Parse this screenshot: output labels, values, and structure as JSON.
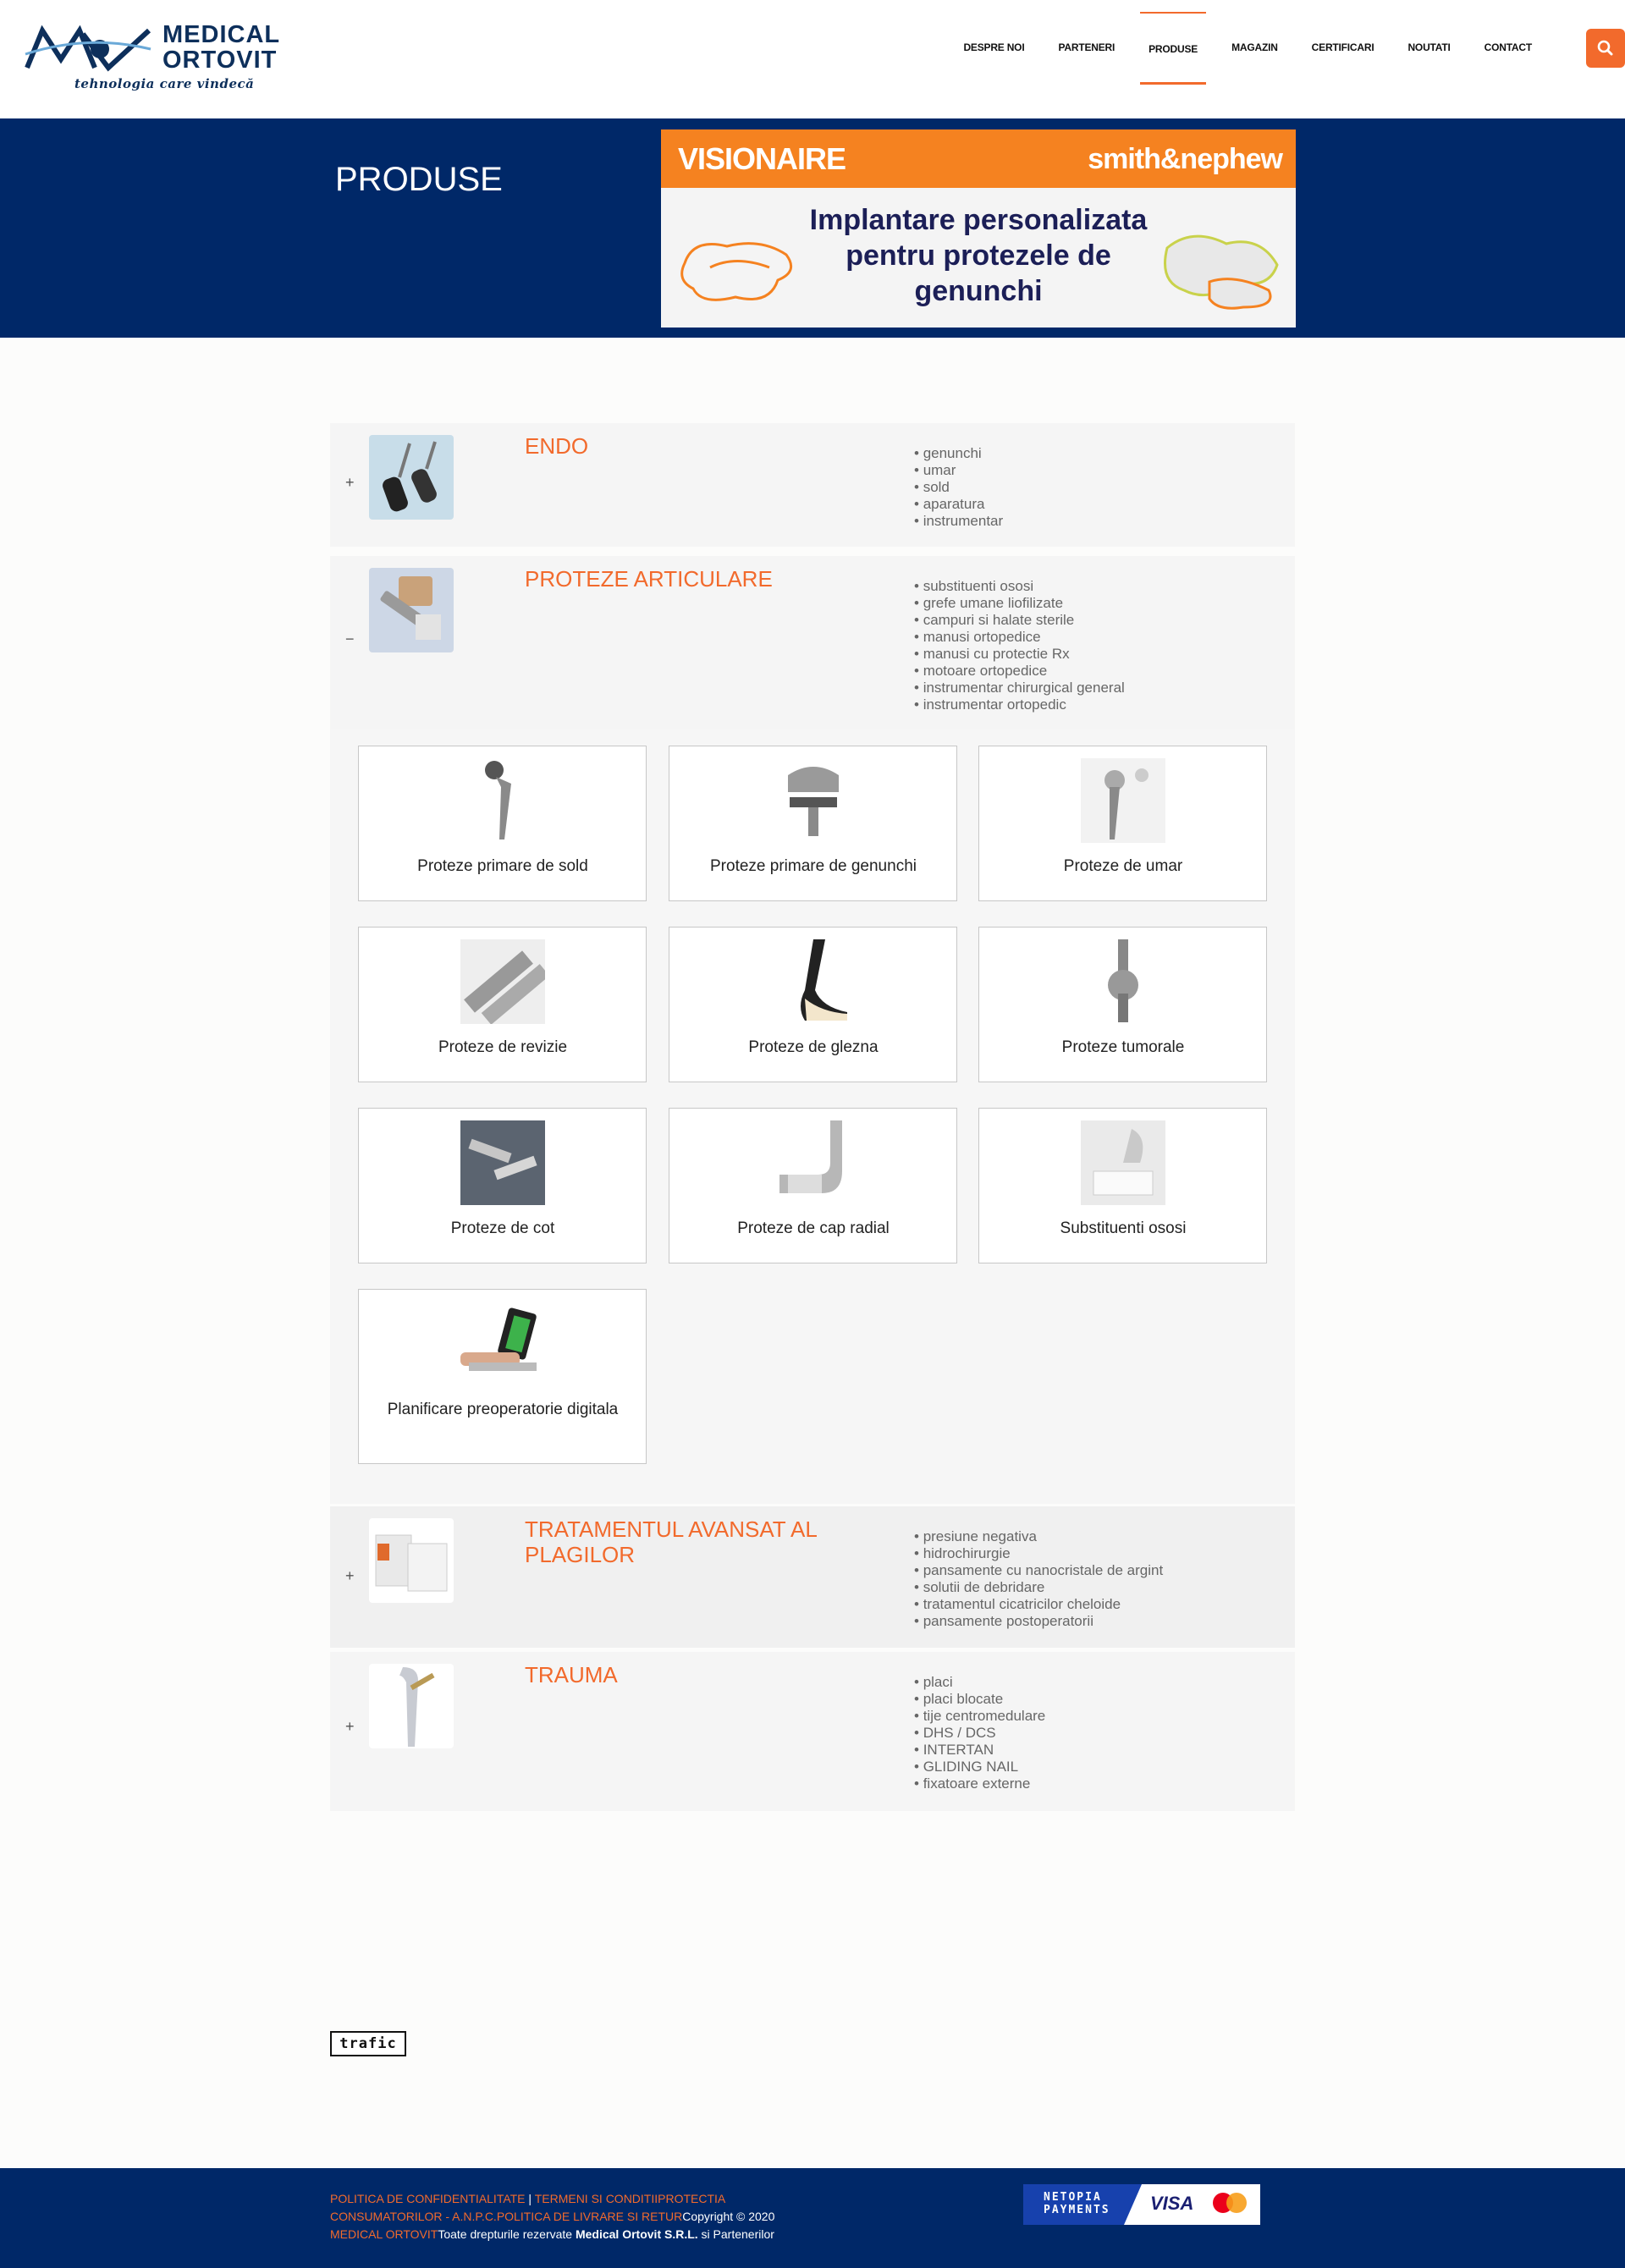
{
  "header": {
    "logo_name_line1": "MEDICAL",
    "logo_name_line2": "ORTOVIT",
    "logo_tagline": "tehnologia care vindecă",
    "nav": [
      "DESPRE NOI",
      "PARTENERI",
      "PRODUSE",
      "MAGAZIN",
      "CERTIFICARI",
      "NOUTATI",
      "CONTACT"
    ],
    "active_nav": "PRODUSE",
    "search_icon": "search-icon",
    "accent_color": "#f26a2c"
  },
  "hero": {
    "title": "PRODUSE",
    "banner": {
      "brand_left": "VISIONAIRE",
      "brand_right": "smith&nephew",
      "headline": "Implantare personalizata pentru protezele de genunchi"
    },
    "background_color": "#002868"
  },
  "categories": [
    {
      "toggle": "+",
      "title": "ENDO",
      "items": [
        "genunchi",
        "umar",
        "sold",
        "aparatura",
        "instrumentar"
      ]
    },
    {
      "toggle": "−",
      "title": "PROTEZE ARTICULARE",
      "items": [
        "substituenti ososi",
        "grefe umane liofilizate",
        "campuri si halate sterile",
        "manusi ortopedice",
        "manusi cu protectie Rx",
        "motoare ortopedice",
        "instrumentar chirurgical general",
        "instrumentar ortopedic"
      ],
      "products": [
        "Proteze primare de sold",
        "Proteze primare de genunchi",
        "Proteze de umar",
        "Proteze de revizie",
        "Proteze de glezna",
        "Proteze tumorale",
        "Proteze de cot",
        "Proteze de cap radial",
        "Substituenti ososi",
        "Planificare preoperatorie digitala"
      ]
    },
    {
      "toggle": "+",
      "title": "TRATAMENTUL AVANSAT AL PLAGILOR",
      "items": [
        "presiune negativa",
        "hidrochirurgie",
        "pansamente cu nanocristale de argint",
        "solutii de debridare",
        "tratamentul cicatricilor cheloide",
        "pansamente postoperatorii"
      ]
    },
    {
      "toggle": "+",
      "title": "TRAUMA",
      "items": [
        "placi",
        "placi blocate",
        "tije centromedulare",
        "DHS / DCS",
        "INTERTAN",
        "GLIDING NAIL",
        "fixatoare externe"
      ]
    }
  ],
  "trafic_badge": "trafic",
  "footer": {
    "link1": "POLITICA DE CONFIDENTIALITATE",
    "separator": "|",
    "link2": "TERMENI SI CONDITII",
    "link3": "PROTECTIA CONSUMATORILOR - A.N.P.C.",
    "link4": "POLITICA DE LIVRARE SI RETUR",
    "copyright": "Copyright © 2020",
    "link5": "MEDICAL ORTOVIT",
    "rights_prefix": "Toate drepturile rezervate ",
    "company": "Medical Ortovit S.R.L.",
    "rights_suffix": " si Partenerilor",
    "payments": {
      "netopia": "NETOPIA PAYMENTS",
      "visa": "VISA",
      "mastercard": "mastercard"
    }
  }
}
